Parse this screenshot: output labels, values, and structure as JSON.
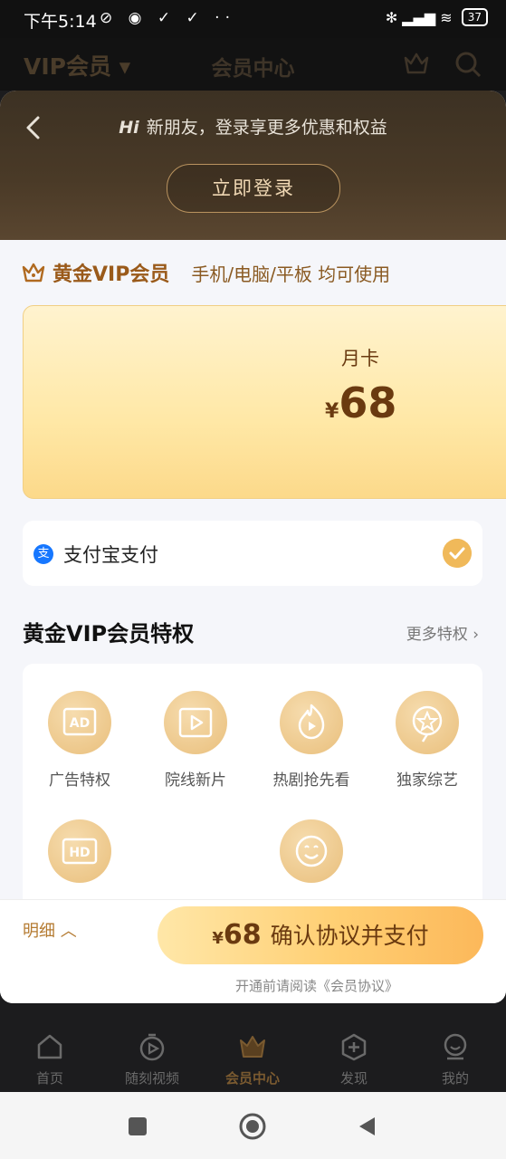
{
  "status": {
    "time": "下午5:14",
    "left_icons": "⊘ ◉ ✓ ✓ ··",
    "right_icons": "✻ ▂▄▆ ≋",
    "battery": "37"
  },
  "appbar": {
    "vip_menu": "VIP会员 ▾",
    "title": "会员中心"
  },
  "sheet": {
    "hi": "Hi",
    "login_tip": "新朋友，登录享更多优惠和权益",
    "login_button": "立即登录",
    "vip_title": "黄金VIP会员",
    "vip_sub": "手机/电脑/平板 均可使用",
    "plan": {
      "name": "月卡",
      "currency": "¥",
      "price": "68"
    },
    "payment": {
      "icon_text": "支",
      "label": "支付宝支付"
    },
    "privileges_title": "黄金VIP会员特权",
    "privileges_more": "更多特权 ›",
    "privileges": [
      {
        "label": "广告特权",
        "icon": "ad-icon"
      },
      {
        "label": "院线新片",
        "icon": "film-icon"
      },
      {
        "label": "热剧抢先看",
        "icon": "fire-play-icon"
      },
      {
        "label": "独家综艺",
        "icon": "star-icon"
      },
      {
        "label": "",
        "icon": "hd-icon"
      },
      {
        "label": "",
        "icon": "emoji-icon"
      }
    ]
  },
  "action": {
    "detail": "明细 ︿",
    "pay_currency": "¥",
    "pay_amount": "68",
    "pay_text": "确认协议并支付",
    "agreement": "开通前请阅读《会员协议》"
  },
  "bottom_nav": [
    {
      "label": "首页",
      "icon": "home-icon"
    },
    {
      "label": "随刻视频",
      "icon": "play-timer-icon"
    },
    {
      "label": "会员中心",
      "icon": "crown-icon"
    },
    {
      "label": "发现",
      "icon": "plus-icon"
    },
    {
      "label": "我的",
      "icon": "profile-icon"
    }
  ],
  "colors": {
    "gold_dark": "#6a3a10",
    "gold_button": "#ffcf73",
    "sheet_bg": "#f5f6fa",
    "alipay_blue": "#1677ff"
  }
}
